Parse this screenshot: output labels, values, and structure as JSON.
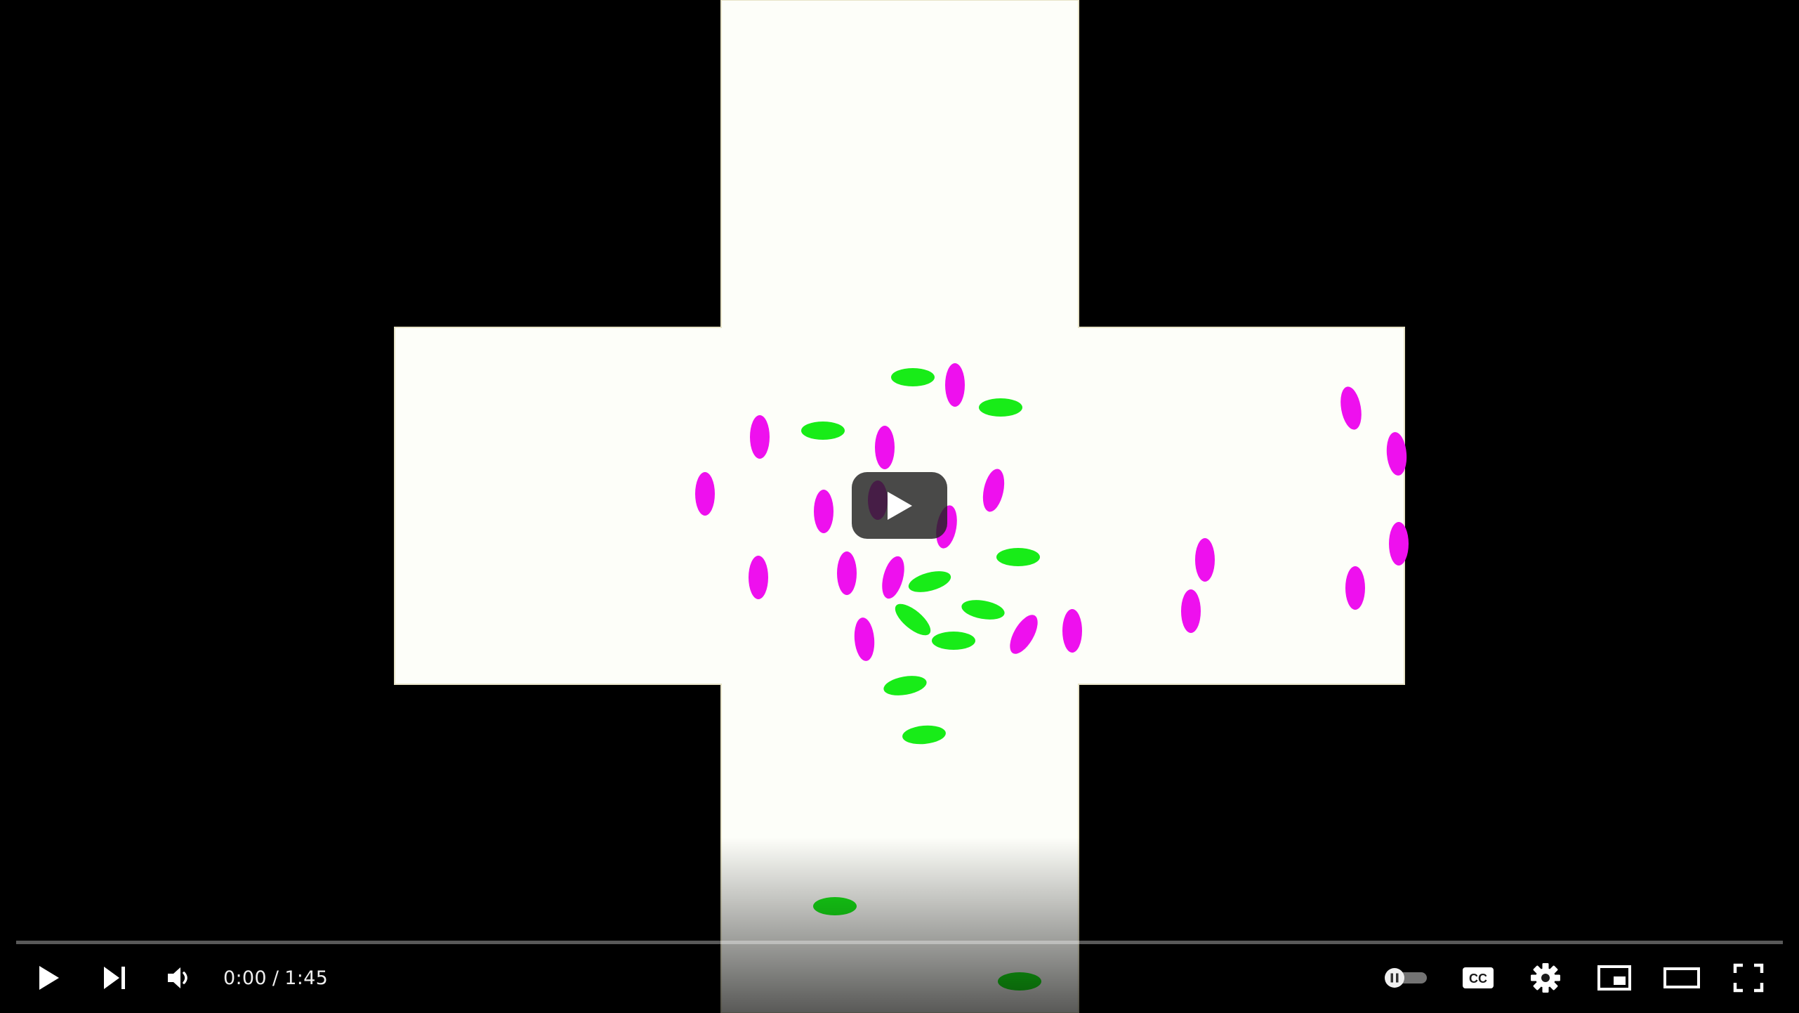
{
  "player": {
    "current_time": "0:00",
    "separator": "/",
    "duration": "1:45",
    "progress_fraction": 0.0,
    "controls": {
      "play": "play-icon",
      "next": "next-icon",
      "volume": "volume-icon",
      "autoplay": "autoplay-toggle-icon",
      "captions": "CC",
      "settings": "gear-icon",
      "miniplayer": "miniplayer-icon",
      "theater": "theater-mode-icon",
      "fullscreen": "fullscreen-icon"
    }
  },
  "video_scene": {
    "background_color": "#000000",
    "channel_color": "#fdfef9",
    "particle_colors": {
      "magenta": "#ee10ee",
      "green": "#18ec18"
    }
  }
}
